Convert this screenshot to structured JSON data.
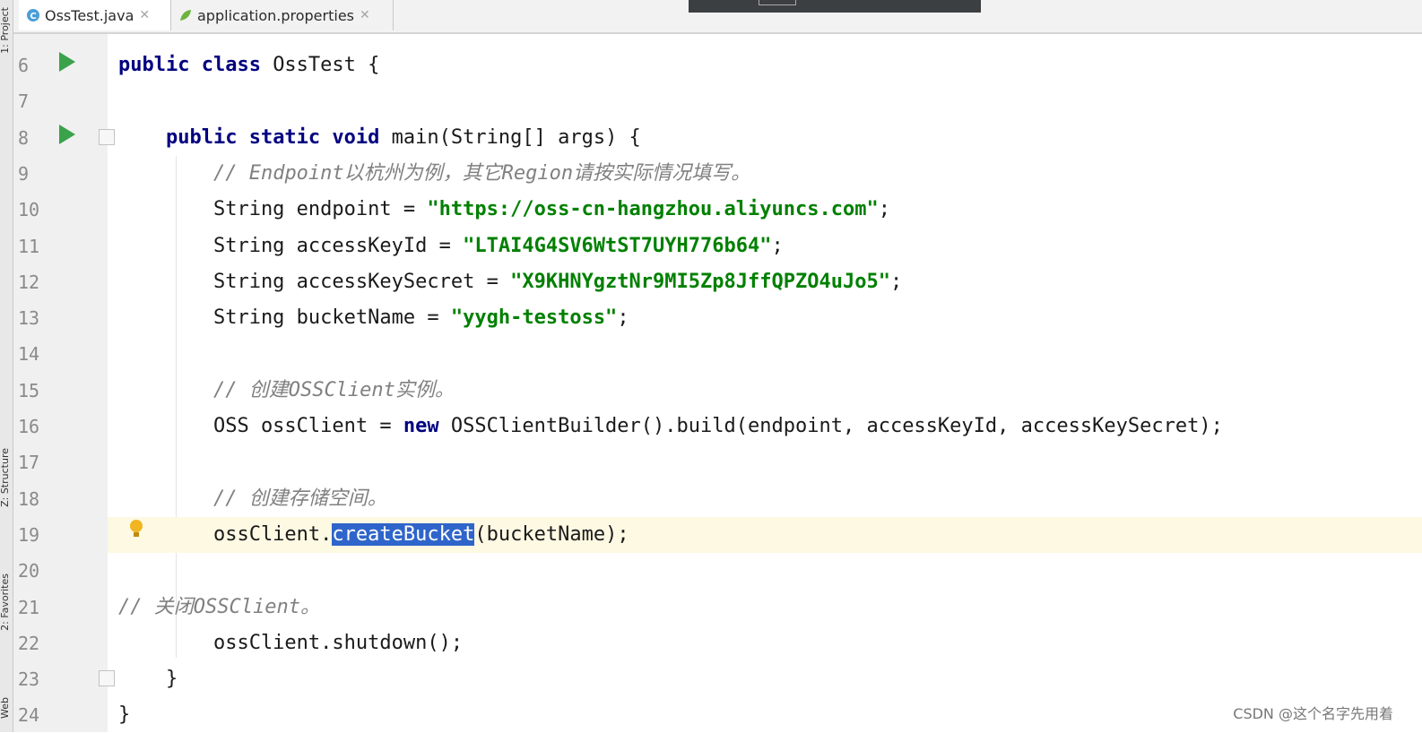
{
  "tabs": [
    {
      "label": "OssTest.java",
      "icon": "java-class-icon",
      "active": true
    },
    {
      "label": "application.properties",
      "icon": "spring-properties-icon",
      "active": false
    }
  ],
  "tool_windows": {
    "project": "1: Project",
    "structure": "Z: Structure",
    "favorites": "2: Favorites",
    "web": "Web"
  },
  "code_lines": [
    {
      "num": "6",
      "tokens": [
        [
          "kw",
          "public class "
        ],
        [
          "",
          "OssTest {"
        ]
      ]
    },
    {
      "num": "7",
      "tokens": []
    },
    {
      "num": "8",
      "tokens": [
        [
          "",
          "    "
        ],
        [
          "kw",
          "public static void "
        ],
        [
          "",
          "main(String[] args) {"
        ]
      ]
    },
    {
      "num": "9",
      "tokens": [
        [
          "",
          "        "
        ],
        [
          "cmt",
          "// Endpoint以杭州为例，其它Region请按实际情况填写。"
        ]
      ]
    },
    {
      "num": "10",
      "tokens": [
        [
          "",
          "        String endpoint = "
        ],
        [
          "str",
          "\"https://oss-cn-hangzhou.aliyuncs.com\""
        ],
        [
          "",
          ";"
        ]
      ]
    },
    {
      "num": "11",
      "tokens": [
        [
          "",
          "        String accessKeyId = "
        ],
        [
          "str",
          "\"LTAI4G4SV6WtST7UYH776b64\""
        ],
        [
          "",
          ";"
        ]
      ]
    },
    {
      "num": "12",
      "tokens": [
        [
          "",
          "        String accessKeySecret = "
        ],
        [
          "str",
          "\"X9KHNYgztNr9MI5Zp8JffQPZO4uJo5\""
        ],
        [
          "",
          ";"
        ]
      ]
    },
    {
      "num": "13",
      "tokens": [
        [
          "",
          "        String bucketName = "
        ],
        [
          "str",
          "\"yygh-testoss\""
        ],
        [
          "",
          ";"
        ]
      ]
    },
    {
      "num": "14",
      "tokens": []
    },
    {
      "num": "15",
      "tokens": [
        [
          "",
          "        "
        ],
        [
          "cmt",
          "// 创建OSSClient实例。"
        ]
      ]
    },
    {
      "num": "16",
      "tokens": [
        [
          "",
          "        OSS ossClient = "
        ],
        [
          "kw",
          "new "
        ],
        [
          "",
          "OSSClientBuilder().build(endpoint, accessKeyId, accessKeySecret);"
        ]
      ]
    },
    {
      "num": "17",
      "tokens": []
    },
    {
      "num": "18",
      "tokens": [
        [
          "",
          "        "
        ],
        [
          "cmt",
          "// 创建存储空间。"
        ]
      ]
    },
    {
      "num": "19",
      "tokens": [
        [
          "",
          "        ossClient."
        ],
        [
          "sel",
          "createBucket"
        ],
        [
          "",
          "(bucketName);"
        ]
      ]
    },
    {
      "num": "20",
      "tokens": []
    },
    {
      "num": "21",
      "tokens": [
        [
          "cmt",
          "// 关闭OSSClient。"
        ]
      ]
    },
    {
      "num": "22",
      "tokens": [
        [
          "",
          "        ossClient.shutdown();"
        ]
      ]
    },
    {
      "num": "23",
      "tokens": [
        [
          "",
          "    }"
        ]
      ]
    },
    {
      "num": "24",
      "tokens": [
        [
          "",
          "}"
        ]
      ]
    }
  ],
  "current_line": "19",
  "watermark": "CSDN @这个名字先用着"
}
